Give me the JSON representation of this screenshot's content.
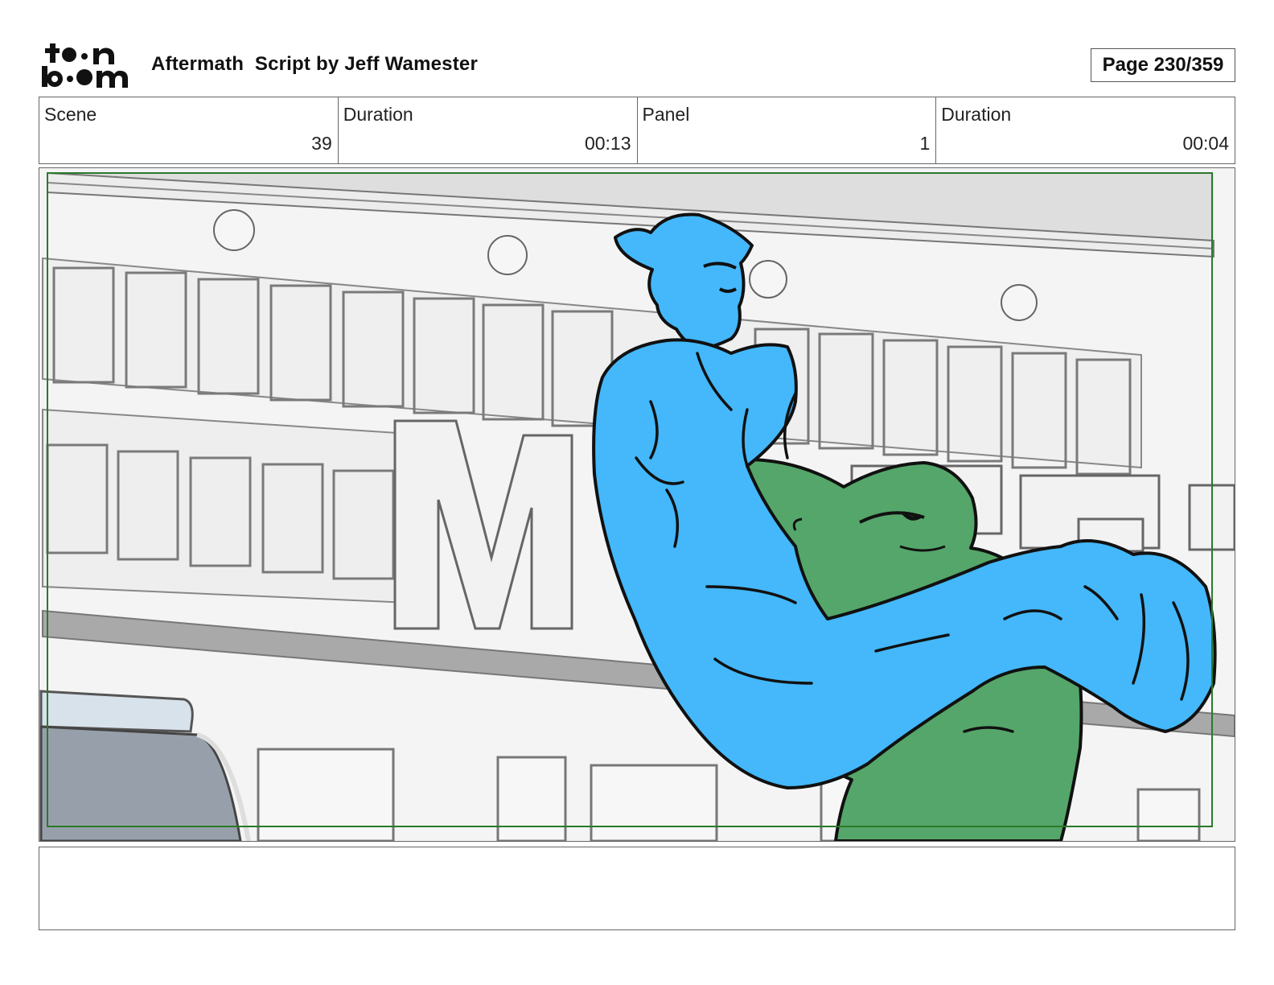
{
  "header": {
    "logo_text_top": "toon",
    "logo_text_bottom": "boom",
    "title": "Aftermath  Script by Jeff Wamester",
    "page": "Page 230/359"
  },
  "info": [
    {
      "label": "Scene",
      "value": "39"
    },
    {
      "label": "Duration",
      "value": "00:13"
    },
    {
      "label": "Panel",
      "value": "1"
    },
    {
      "label": "Duration",
      "value": "00:04"
    }
  ],
  "panel": {
    "colors": {
      "hero": "#44b8fb",
      "monster": "#55a66a",
      "frame": "#2a7a2a"
    }
  },
  "notes": {
    "text": ""
  }
}
